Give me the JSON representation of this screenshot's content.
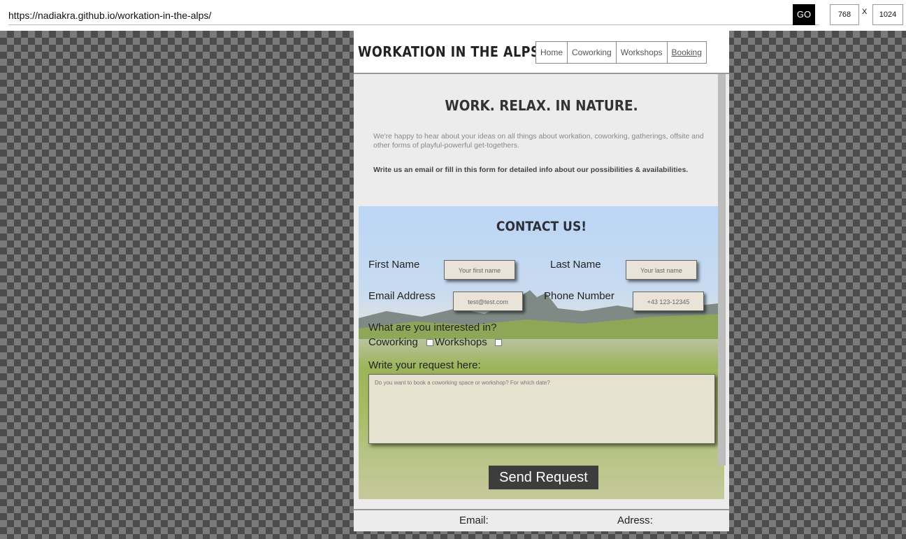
{
  "browser": {
    "url": "https://nadiakra.github.io/workation-in-the-alps/",
    "go_label": "GO",
    "width_value": "768",
    "height_value": "1024",
    "times": "X"
  },
  "site": {
    "logo": "WORKATION IN THE ALPS",
    "nav": [
      "Home",
      "Coworking",
      "Workshops",
      "Booking"
    ],
    "active_nav": "Booking",
    "tagline": "WORK. RELAX. IN NATURE.",
    "intro_1": "We're happy to hear about your ideas on all things about workation, coworking, gatherings, offsite and other forms of playful-powerful get-togethers.",
    "intro_2": "Write us an email or fill in this form for detailed info about our possibilities & availabilities."
  },
  "form": {
    "title": "CONTACT US!",
    "first_name_label": "First Name",
    "first_name_placeholder": "Your first name",
    "last_name_label": "Last Name",
    "last_name_placeholder": "Your last name",
    "email_label": "Email Address",
    "email_placeholder": "test@test.com",
    "phone_label": "Phone Number",
    "phone_placeholder": "+43 123-12345",
    "interest_question": "What are you interested in?",
    "option_coworking": "Coworking",
    "option_workshops": "Workshops",
    "request_label": "Write your request here:",
    "request_placeholder": "Do you want to book a coworking space or workshop? For which date?",
    "send_label": "Send Request"
  },
  "footer": {
    "email_label": "Email:",
    "address_label": "Adress:"
  }
}
